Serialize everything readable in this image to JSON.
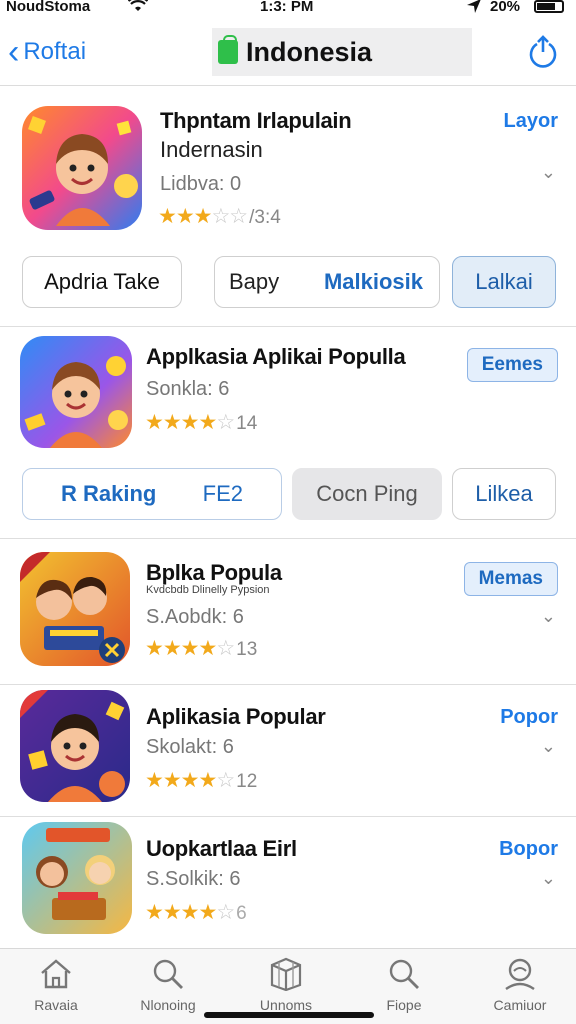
{
  "status_bar": {
    "carrier": "NoudStoma",
    "time": "1:3: PM",
    "battery": "20%"
  },
  "nav": {
    "back_label": "Roftai",
    "title": "Indonesia"
  },
  "apps": [
    {
      "name": "Thpntam Irlapulain",
      "subtitle": "Indernasin",
      "meta": "Lidbva: 0",
      "rating_count": "/3:4",
      "action": "Layor"
    },
    {
      "name": "Applkasia Aplikai Populla",
      "meta": "Sonkla: 6",
      "rating_count": "14",
      "action": "Eemes"
    },
    {
      "name": "Bplka Popula",
      "tagline": "Kvdcbdb Dlinelly Pypsion",
      "meta": "S.Aobdk: 6",
      "rating_count": "13",
      "action": "Memas"
    },
    {
      "name": "Aplikasia Popular",
      "meta": "Skolakt: 6",
      "rating_count": "12",
      "action": "Popor"
    },
    {
      "name": "Uopkartlaa Eirl",
      "meta": "S.Solkik: 6",
      "rating_count": "6",
      "action": "Bopor"
    }
  ],
  "segments_1": {
    "left": "Apdria Take",
    "mid_a": "Bapy",
    "mid_b": "Malkiosik",
    "right": "Lalkai"
  },
  "segments_2": {
    "left_a": "R Raking",
    "left_b": "FE2",
    "mid": "Cocn Ping",
    "right": "Lilkea"
  },
  "tabs": [
    {
      "label": "Ravaia",
      "icon": "home-icon"
    },
    {
      "label": "Nlonoing",
      "icon": "search-icon"
    },
    {
      "label": "Unnoms",
      "icon": "apps-icon"
    },
    {
      "label": "Fiope",
      "icon": "search-icon"
    },
    {
      "label": "Camiuor",
      "icon": "profile-icon"
    }
  ],
  "colors": {
    "accent": "#1e7ae6",
    "star": "#f2a91b",
    "store_green": "#2fbf4a"
  }
}
